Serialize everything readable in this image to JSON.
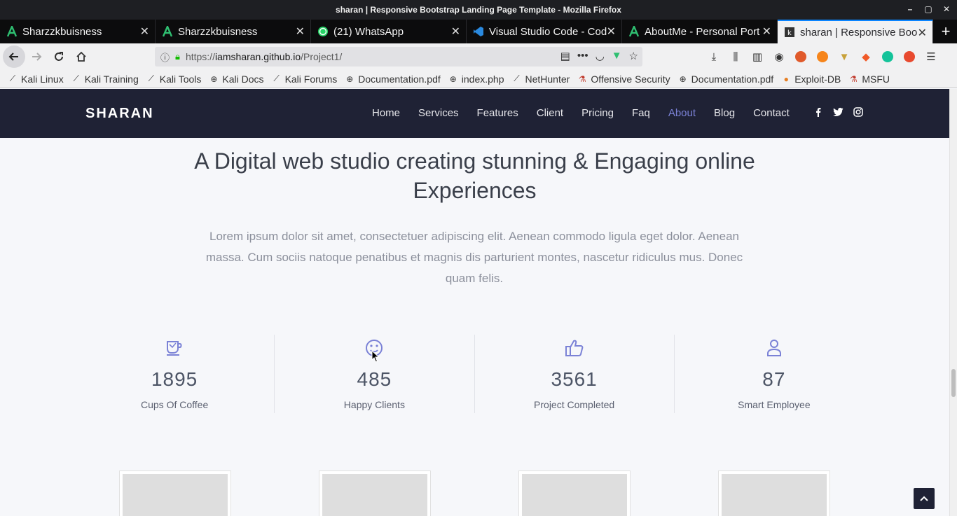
{
  "window": {
    "title": "sharan | Responsive Bootstrap Landing Page Template - Mozilla Firefox",
    "controls": [
      "–",
      "▢",
      "✕"
    ]
  },
  "tabs": [
    {
      "label": "Sharzzkbuisness",
      "icon": "a-brand-icon",
      "close": "✕"
    },
    {
      "label": "Sharzzkbuisness",
      "icon": "a-brand-icon",
      "close": "✕"
    },
    {
      "label": "(21) WhatsApp",
      "icon": "whatsapp-icon",
      "close": "✕"
    },
    {
      "label": "Visual Studio Code - Cod",
      "icon": "vscode-icon",
      "close": "✕"
    },
    {
      "label": "AboutMe - Personal Port",
      "icon": "a-brand-icon",
      "close": "✕"
    },
    {
      "label": "sharan | Responsive Boo",
      "icon": "k-favicon-icon",
      "close": "✕",
      "active": true
    }
  ],
  "newtab_label": "+",
  "urlbar": {
    "host_prefix": "https://",
    "host": "iamsharan.github.io",
    "path": "/Project1/"
  },
  "bookmarks": [
    {
      "label": "Kali Linux",
      "icon": "kali-icon"
    },
    {
      "label": "Kali Training",
      "icon": "kali-icon"
    },
    {
      "label": "Kali Tools",
      "icon": "kali-icon"
    },
    {
      "label": "Kali Docs",
      "icon": "globe-icon"
    },
    {
      "label": "Kali Forums",
      "icon": "kali-icon"
    },
    {
      "label": "Documentation.pdf",
      "icon": "globe-icon"
    },
    {
      "label": "index.php",
      "icon": "globe-icon"
    },
    {
      "label": "NetHunter",
      "icon": "kali-icon"
    },
    {
      "label": "Offensive Security",
      "icon": "offsec-icon"
    },
    {
      "label": "Documentation.pdf",
      "icon": "globe-icon"
    },
    {
      "label": "Exploit-DB",
      "icon": "exploitdb-icon"
    },
    {
      "label": "MSFU",
      "icon": "offsec-icon"
    }
  ],
  "site": {
    "brand": "SHARAN",
    "menu": [
      "Home",
      "Services",
      "Features",
      "Client",
      "Pricing",
      "Faq",
      "About",
      "Blog",
      "Contact"
    ],
    "active_menu": "About",
    "social": [
      "facebook-icon",
      "twitter-icon",
      "instagram-icon"
    ]
  },
  "content": {
    "heading": "A Digital web studio creating stunning & Engaging online Experiences",
    "lead": "Lorem ipsum dolor sit amet, consectetuer adipiscing elit. Aenean commodo ligula eget dolor. Aenean massa. Cum sociis natoque penatibus et magnis dis parturient montes, nascetur ridiculus mus. Donec quam felis.",
    "stats": [
      {
        "value": "1895",
        "label": "Cups Of Coffee",
        "icon": "coffee-cup-icon"
      },
      {
        "value": "485",
        "label": "Happy Clients",
        "icon": "smiley-icon"
      },
      {
        "value": "3561",
        "label": "Project Completed",
        "icon": "thumbs-up-icon"
      },
      {
        "value": "87",
        "label": "Smart Employee",
        "icon": "user-icon"
      }
    ]
  },
  "colors": {
    "site_header": "#1f2235",
    "accent": "#7b82d6",
    "page_bg": "#f6f7fa"
  }
}
